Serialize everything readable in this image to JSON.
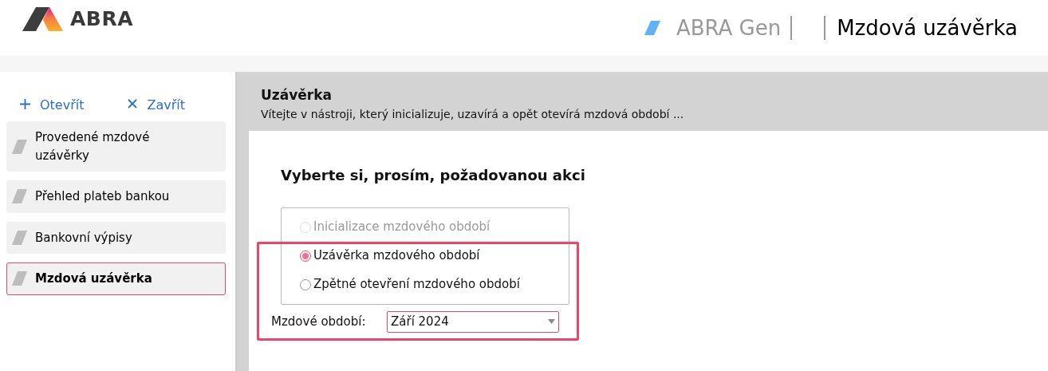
{
  "header": {
    "logo_text": "ABRA",
    "app_name": "ABRA Gen",
    "page_title": "Mzdová uzávěrka"
  },
  "toolbar": [
    {
      "kind": "open",
      "label": "Otevřít"
    },
    {
      "kind": "close",
      "label": "Zavřít"
    }
  ],
  "sidebar": {
    "items": [
      {
        "label": "Provedené mzdové uzávěrky",
        "selected": false
      },
      {
        "label": "Přehled plateb bankou",
        "selected": false
      },
      {
        "label": "Bankovní výpisy",
        "selected": false
      },
      {
        "label": "Mzdová uzávěrka",
        "selected": true
      }
    ]
  },
  "panel": {
    "title": "Uzávěrka",
    "subtitle": "Vítejte v nástroji, který inicializuje, uzavírá a opět otevírá mzdová období ..."
  },
  "form": {
    "heading": "Vyberte si, prosím, požadovanou akci",
    "highlighted": true,
    "options": [
      {
        "label": "Inicializace mzdového období",
        "selected": false,
        "disabled": true
      },
      {
        "label": "Uzávěrka mzdového období",
        "selected": true,
        "disabled": false
      },
      {
        "label": "Zpětné otevření mzdového období",
        "selected": false,
        "disabled": false
      }
    ],
    "period_label": "Mzdové období:",
    "period_value": "Září 2024"
  }
}
